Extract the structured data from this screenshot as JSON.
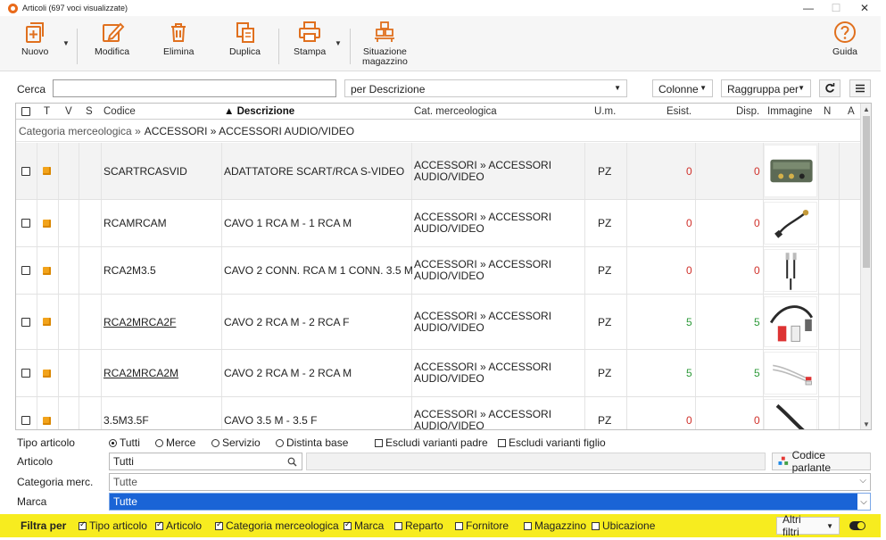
{
  "window": {
    "title": "Articoli (697 voci visualizzate)",
    "minimize": "—",
    "maximize": "☐",
    "close": "✕"
  },
  "toolbar": {
    "nuovo": "Nuovo",
    "modifica": "Modifica",
    "elimina": "Elimina",
    "duplica": "Duplica",
    "stampa": "Stampa",
    "situazione_line1": "Situazione",
    "situazione_line2": "magazzino",
    "guida": "Guida",
    "accent": "#e0701e"
  },
  "search": {
    "label": "Cerca",
    "value": "",
    "mode": "per Descrizione",
    "colonne": "Colonne",
    "raggruppa": "Raggruppa per"
  },
  "table": {
    "headers": {
      "t": "T",
      "v": "V",
      "s": "S",
      "codice": "Codice",
      "descrizione": "▲ Descrizione",
      "cat": "Cat. merceologica",
      "um": "U.m.",
      "esist": "Esist.",
      "disp": "Disp.",
      "immagine": "Immagine",
      "n": "N",
      "a": "A"
    },
    "group": {
      "key": "Categoria merceologica »",
      "value": "ACCESSORI » ACCESSORI AUDIO/VIDEO"
    },
    "rows": [
      {
        "codice": "SCARTRCASVID",
        "descrizione": "ADATTATORE SCART/RCA S-VIDEO",
        "cat1": "ACCESSORI » ACCESSORI",
        "cat2": "AUDIO/VIDEO",
        "um": "PZ",
        "esist": "0",
        "disp": "0"
      },
      {
        "codice": "RCAMRCAM",
        "descrizione": "CAVO 1 RCA M - 1 RCA M",
        "cat1": "ACCESSORI » ACCESSORI",
        "cat2": "AUDIO/VIDEO",
        "um": "PZ",
        "esist": "0",
        "disp": "0"
      },
      {
        "codice": "RCA2M3.5",
        "descrizione": "CAVO 2 CONN. RCA M 1 CONN. 3.5 M",
        "cat1": "ACCESSORI » ACCESSORI",
        "cat2": "AUDIO/VIDEO",
        "um": "PZ",
        "esist": "0",
        "disp": "0"
      },
      {
        "codice": "RCA2MRCA2F",
        "descrizione": "CAVO 2 RCA M - 2 RCA F",
        "cat1": "ACCESSORI » ACCESSORI",
        "cat2": "AUDIO/VIDEO",
        "um": "PZ",
        "esist": "5",
        "disp": "5"
      },
      {
        "codice": "RCA2MRCA2M",
        "descrizione": "CAVO 2 RCA M - 2 RCA M",
        "cat1": "ACCESSORI » ACCESSORI",
        "cat2": "AUDIO/VIDEO",
        "um": "PZ",
        "esist": "5",
        "disp": "5"
      },
      {
        "codice": "3.5M3.5F",
        "descrizione": "CAVO 3.5 M - 3.5 F",
        "cat1": "ACCESSORI » ACCESSORI",
        "cat2": "AUDIO/VIDEO",
        "um": "PZ",
        "esist": "0",
        "disp": "0"
      }
    ]
  },
  "filters": {
    "tipo_label": "Tipo articolo",
    "tipo_tutti": "Tutti",
    "tipo_merce": "Merce",
    "tipo_servizio": "Servizio",
    "tipo_distinta": "Distinta base",
    "escludi_padre": "Escludi varianti padre",
    "escludi_figlio": "Escludi varianti figlio",
    "articolo_label": "Articolo",
    "articolo_value": "Tutti",
    "codice_parlante": "Codice parlante",
    "categoria_label": "Categoria merc.",
    "categoria_value": "Tutte",
    "marca_label": "Marca",
    "marca_value": "Tutte"
  },
  "filterbar": {
    "filtra_per": "Filtra per",
    "tipo_articolo": "Tipo articolo",
    "articolo": "Articolo",
    "categoria": "Categoria merceologica",
    "marca": "Marca",
    "reparto": "Reparto",
    "fornitore": "Fornitore",
    "magazzino": "Magazzino",
    "ubicazione": "Ubicazione",
    "altri_filtri": "Altri filtri",
    "background": "#f7ec1f"
  }
}
